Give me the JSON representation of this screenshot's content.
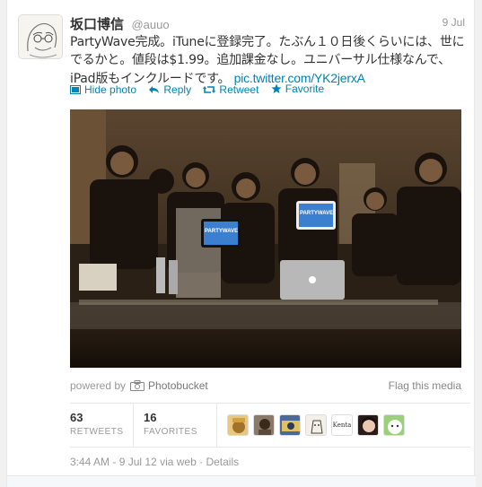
{
  "tweet": {
    "fullname": "坂口博信",
    "username": "@auuo",
    "date": "9 Jul",
    "text_line1": "PartyWave完成。iTuneに登録完了。たぶん１０日後くらいには、世に",
    "text_line2": "でるかと。値段は$1.99。追加課金なし。ユニバーサル仕様なんで、",
    "text_line3": "iPad版もインクルードです。",
    "link": "pic.twitter.com/YK2jerxA"
  },
  "actions": {
    "hide_photo": "Hide photo",
    "reply": "Reply",
    "retweet": "Retweet",
    "favorite": "Favorite"
  },
  "media": {
    "powered_by": "powered by",
    "provider": "Photobucket",
    "flag": "Flag this media",
    "ipad_left_label": "PARTYWAVE",
    "ipad_right_label": "PARTYWAVE"
  },
  "stats": {
    "retweets_count": "63",
    "retweets_label": "RETWEETS",
    "favorites_count": "16",
    "favorites_label": "FAVORITES",
    "face_text": "Kenta"
  },
  "meta": {
    "time": "3:44 AM - 9 Jul 12",
    "via": "via web",
    "sep": "·",
    "details": "Details"
  },
  "colors": {
    "link": "#0084b4",
    "muted": "#999999"
  }
}
